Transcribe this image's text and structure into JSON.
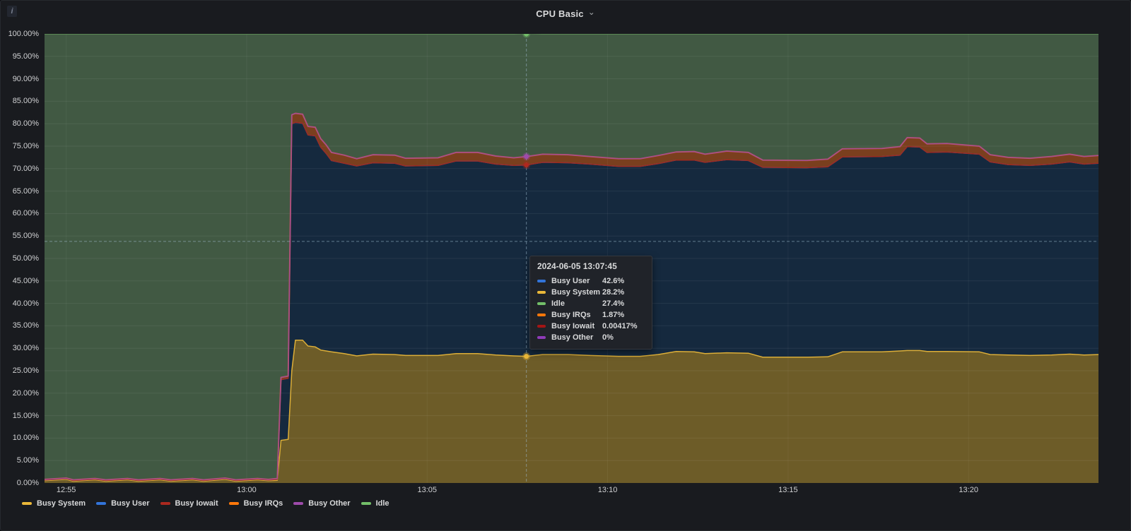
{
  "panel": {
    "title": "CPU Basic",
    "icons": {
      "chevron_down": "⌄",
      "info": "i"
    },
    "background": "#191b1f"
  },
  "chart_data": {
    "type": "area",
    "stacked": true,
    "title": "CPU Basic",
    "xlabel": "",
    "ylabel": "",
    "ylim": [
      0,
      100
    ],
    "x_unit": "minutes_after_12:54",
    "xlim": [
      0.4,
      29.6
    ],
    "grid": true,
    "legend_position": "bottom-left",
    "x_ticks": [
      {
        "t": 1,
        "label": "12:55"
      },
      {
        "t": 6,
        "label": "13:00"
      },
      {
        "t": 11,
        "label": "13:05"
      },
      {
        "t": 16,
        "label": "13:10"
      },
      {
        "t": 21,
        "label": "13:15"
      },
      {
        "t": 26,
        "label": "13:20"
      }
    ],
    "y_ticks": [
      {
        "v": 0,
        "label": "0.00%"
      },
      {
        "v": 5,
        "label": "5.00%"
      },
      {
        "v": 10,
        "label": "10.00%"
      },
      {
        "v": 15,
        "label": "15.00%"
      },
      {
        "v": 20,
        "label": "20.00%"
      },
      {
        "v": 25,
        "label": "25.00%"
      },
      {
        "v": 30,
        "label": "30.00%"
      },
      {
        "v": 35,
        "label": "35.00%"
      },
      {
        "v": 40,
        "label": "40.00%"
      },
      {
        "v": 45,
        "label": "45.00%"
      },
      {
        "v": 50,
        "label": "50.00%"
      },
      {
        "v": 55,
        "label": "55.00%"
      },
      {
        "v": 60,
        "label": "60.00%"
      },
      {
        "v": 65,
        "label": "65.00%"
      },
      {
        "v": 70,
        "label": "70.00%"
      },
      {
        "v": 75,
        "label": "75.00%"
      },
      {
        "v": 80,
        "label": "80.00%"
      },
      {
        "v": 85,
        "label": "85.00%"
      },
      {
        "v": 90,
        "label": "90.00%"
      },
      {
        "v": 95,
        "label": "95.00%"
      },
      {
        "v": 100,
        "label": "100.00%"
      }
    ],
    "t": [
      0.4,
      1.0,
      1.2,
      1.8,
      2.1,
      2.7,
      3.0,
      3.6,
      3.9,
      4.5,
      4.8,
      5.4,
      5.7,
      6.3,
      6.6,
      6.85,
      6.95,
      7.15,
      7.25,
      7.35,
      7.55,
      7.7,
      7.9,
      8.05,
      8.2,
      8.35,
      8.7,
      9.05,
      9.5,
      10.1,
      10.4,
      11.3,
      11.8,
      12.4,
      12.9,
      13.4,
      13.75,
      14.2,
      14.9,
      15.5,
      16.3,
      16.9,
      17.4,
      17.9,
      18.4,
      18.7,
      19.3,
      19.9,
      20.3,
      21.5,
      22.1,
      22.5,
      23.6,
      24.1,
      24.3,
      24.65,
      24.85,
      25.4,
      26.3,
      26.6,
      27.1,
      27.7,
      28.3,
      28.8,
      29.2,
      29.6
    ],
    "series": [
      {
        "name": "Busy System",
        "color": "#eab839",
        "fill": "#6d5c28",
        "line": "#dcae38",
        "lw": 1.5,
        "values": [
          0.5,
          0.8,
          0.4,
          0.7,
          0.4,
          0.7,
          0.4,
          0.7,
          0.4,
          0.7,
          0.4,
          0.8,
          0.4,
          0.7,
          0.5,
          0.6,
          9.5,
          9.7,
          25.0,
          31.8,
          31.8,
          30.5,
          30.3,
          29.6,
          29.4,
          29.2,
          28.8,
          28.3,
          28.7,
          28.6,
          28.4,
          28.4,
          28.8,
          28.8,
          28.5,
          28.3,
          28.2,
          28.6,
          28.6,
          28.4,
          28.2,
          28.2,
          28.6,
          29.3,
          29.2,
          28.8,
          29.0,
          28.9,
          28.0,
          28.0,
          28.1,
          29.2,
          29.2,
          29.4,
          29.5,
          29.5,
          29.3,
          29.3,
          29.2,
          28.6,
          28.5,
          28.4,
          28.5,
          28.7,
          28.5,
          28.6
        ]
      },
      {
        "name": "Busy User",
        "color": "#3274d9",
        "fill": "#15293e",
        "line": "#3a6fc0",
        "lw": 1.5,
        "values": [
          0.15,
          0.15,
          0.15,
          0.15,
          0.15,
          0.15,
          0.15,
          0.15,
          0.15,
          0.15,
          0.15,
          0.15,
          0.15,
          0.15,
          0.15,
          0.2,
          13.5,
          13.6,
          55.0,
          48.5,
          48.3,
          47.0,
          47.0,
          45.2,
          44.0,
          42.6,
          42.4,
          42.3,
          42.6,
          42.6,
          42.2,
          42.3,
          42.9,
          42.9,
          42.5,
          42.4,
          42.6,
          42.8,
          42.7,
          42.6,
          42.3,
          42.3,
          42.5,
          42.6,
          42.7,
          42.6,
          43.0,
          42.9,
          42.3,
          42.2,
          42.3,
          43.4,
          43.5,
          43.6,
          45.4,
          45.3,
          44.3,
          44.4,
          44.0,
          42.9,
          42.4,
          42.3,
          42.5,
          42.8,
          42.5,
          42.6
        ]
      },
      {
        "name": "Busy Iowait",
        "color": "#ac291f",
        "fill": null,
        "line": "#9e2a1e",
        "lw": 1.5,
        "values": 0.004
      },
      {
        "name": "Busy IRQs",
        "color": "#ff780a",
        "fill": "#7a3f1e",
        "line": "#c65a1f",
        "lw": 2,
        "values": [
          0.15,
          0.15,
          0.15,
          0.15,
          0.15,
          0.15,
          0.15,
          0.15,
          0.15,
          0.15,
          0.15,
          0.15,
          0.15,
          0.15,
          0.15,
          0.2,
          0.5,
          0.5,
          2.0,
          2.0,
          2.0,
          1.9,
          1.9,
          1.9,
          1.9,
          1.8,
          1.8,
          1.6,
          1.8,
          1.8,
          1.7,
          1.7,
          1.9,
          1.9,
          1.8,
          1.7,
          1.87,
          1.8,
          1.8,
          1.7,
          1.7,
          1.7,
          1.8,
          1.8,
          1.9,
          1.8,
          1.9,
          1.8,
          1.6,
          1.6,
          1.7,
          1.8,
          1.8,
          1.9,
          2.0,
          2.0,
          1.9,
          1.9,
          1.8,
          1.6,
          1.6,
          1.6,
          1.7,
          1.7,
          1.7,
          1.7
        ]
      },
      {
        "name": "Busy Other",
        "color": "#9e4bab",
        "fill": null,
        "line": "rgba(158,75,171,0.85)",
        "lw": 1.5,
        "values": 0
      },
      {
        "name": "Idle",
        "color": "#73bf69",
        "fill": "#415943",
        "line": "#64995a",
        "lw": 1.5,
        "values": [
          99.2,
          98.9,
          99.3,
          99.0,
          99.3,
          99.0,
          99.3,
          99.0,
          99.3,
          99.0,
          99.3,
          98.9,
          99.3,
          99.0,
          99.2,
          99.0,
          76.5,
          76.2,
          18.0,
          17.7,
          17.9,
          20.6,
          20.8,
          23.3,
          24.7,
          26.4,
          27.0,
          27.8,
          26.9,
          27.0,
          27.7,
          27.6,
          26.4,
          26.4,
          27.2,
          27.6,
          27.4,
          26.8,
          26.9,
          27.3,
          27.8,
          27.8,
          27.1,
          26.3,
          26.2,
          26.8,
          26.1,
          26.4,
          28.1,
          28.2,
          27.9,
          25.6,
          25.5,
          25.1,
          23.1,
          23.2,
          24.5,
          24.4,
          25.0,
          26.9,
          27.5,
          27.7,
          27.3,
          26.8,
          27.3,
          27.1
        ]
      }
    ],
    "grid_color_h": "rgba(255,255,255,0.07)",
    "grid_color_v": "rgba(255,255,255,0.05)"
  },
  "crosshair": {
    "t": 13.75,
    "y_pct": 53.8,
    "line_color": "rgba(160,190,210,0.55)",
    "points": [
      {
        "series": "Idle",
        "pct": 100,
        "color": "#73bf69"
      },
      {
        "series": "Busy Other",
        "pct": 72.7,
        "color": "#9e4bab"
      },
      {
        "series": "Busy Iowait",
        "pct": 70.8,
        "color": "#b0281e"
      },
      {
        "series": "Busy System",
        "pct": 28.2,
        "color": "#eab839"
      }
    ]
  },
  "tooltip": {
    "title": "2024-06-05 13:07:45",
    "rows": [
      {
        "name": "Busy User",
        "value": "42.6%",
        "color": "#3274d9"
      },
      {
        "name": "Busy System",
        "value": "28.2%",
        "color": "#eab839"
      },
      {
        "name": "Idle",
        "value": "27.4%",
        "color": "#73bf69"
      },
      {
        "name": "Busy IRQs",
        "value": "1.87%",
        "color": "#ff780a"
      },
      {
        "name": "Busy Iowait",
        "value": "0.00417%",
        "color": "#a31515"
      },
      {
        "name": "Busy Other",
        "value": "0%",
        "color": "#8f3bb8"
      }
    ]
  },
  "legend": {
    "items": [
      {
        "label": "Busy System",
        "color": "#eab839"
      },
      {
        "label": "Busy User",
        "color": "#3274d9"
      },
      {
        "label": "Busy Iowait",
        "color": "#ac291f"
      },
      {
        "label": "Busy IRQs",
        "color": "#ff780a"
      },
      {
        "label": "Busy Other",
        "color": "#9e4bab"
      },
      {
        "label": "Idle",
        "color": "#73bf69"
      }
    ]
  }
}
